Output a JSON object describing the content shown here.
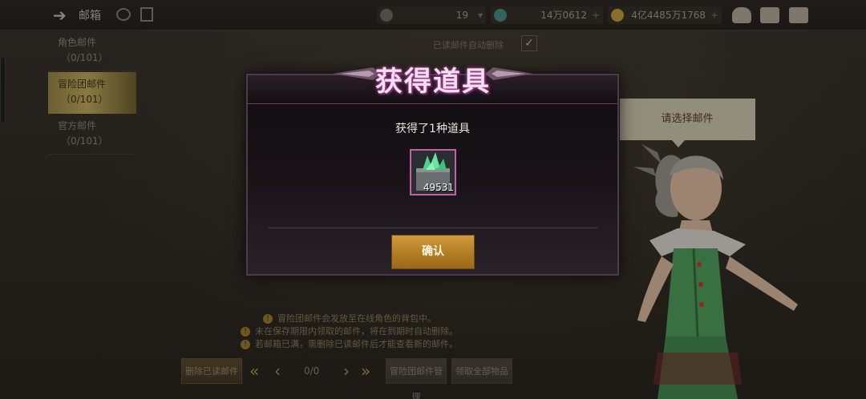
{
  "topbar": {
    "title": "邮箱",
    "resource_level": "19",
    "resource_crystal": "14万0612",
    "resource_gold": "4亿4485万1768"
  },
  "tabs": [
    {
      "label": "角色邮件",
      "count": "（0/101）"
    },
    {
      "label": "冒险团邮件",
      "count": "（0/101）"
    },
    {
      "label": "官方邮件",
      "count": "（0/101）"
    }
  ],
  "auto_delete_label": "已读邮件自动删除",
  "select_mail_label": "请选择邮件",
  "notes": [
    "冒险团邮件会发放至在线角色的背包中。",
    "未在保存期限内领取的邮件，将在到期时自动删除。",
    "若邮箱已满，需删除已读邮件后才能查看新的邮件。"
  ],
  "bottom": {
    "delete_read": "删除已读邮件",
    "pager": "0/0",
    "manage": "冒险团邮件管理",
    "receive_all": "领取全部物品"
  },
  "dialog": {
    "title": "获得道具",
    "message": "获得了1种道具",
    "item_count": "49531",
    "confirm": "确认"
  },
  "colors": {
    "dialog_border": "#c35ea7",
    "confirm_button": "#b27c23",
    "active_tab": "#c7b160"
  }
}
